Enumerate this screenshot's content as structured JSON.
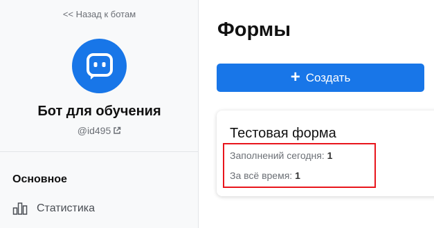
{
  "sidebar": {
    "back_link": "<< Назад к ботам",
    "bot_name": "Бот для обучения",
    "bot_id": "@id495",
    "section_title": "Основное",
    "nav_items": [
      {
        "label": "Статистика",
        "icon": "bar-chart-icon"
      }
    ]
  },
  "main": {
    "page_title": "Формы",
    "create_button": {
      "label": "Создать",
      "icon": "plus-icon"
    },
    "forms": [
      {
        "title": "Тестовая форма",
        "today_label": "Заполнений сегодня:",
        "today_value": "1",
        "all_time_label": "За всё время:",
        "all_time_value": "1"
      }
    ]
  },
  "colors": {
    "accent": "#1876e8",
    "highlight_border": "#e8141b",
    "sidebar_bg": "#f8f9fa"
  }
}
